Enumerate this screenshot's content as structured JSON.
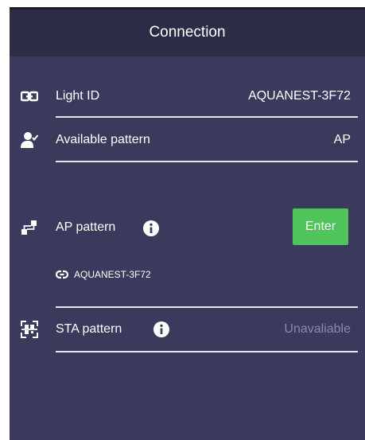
{
  "header": {
    "title": "Connection"
  },
  "light_id": {
    "label": "Light ID",
    "value": "AQUANEST-3F72",
    "icon": "link-icon"
  },
  "available_pattern": {
    "label": "Available pattern",
    "value": "AP",
    "icon": "user-check-icon"
  },
  "ap_pattern": {
    "label": "AP pattern",
    "icon": "ap-connect-icon",
    "button_label": "Enter",
    "ssid": "AQUANEST-3F72",
    "ssid_icon": "chain-link-icon"
  },
  "sta_pattern": {
    "label": "STA pattern",
    "icon": "qr-scan-icon",
    "status": "Unavaliable"
  },
  "colors": {
    "header_bg": "#2b2c45",
    "body_bg": "#3a3b5c",
    "button": "#4fc45a",
    "muted_text": "#8a8ca6"
  }
}
